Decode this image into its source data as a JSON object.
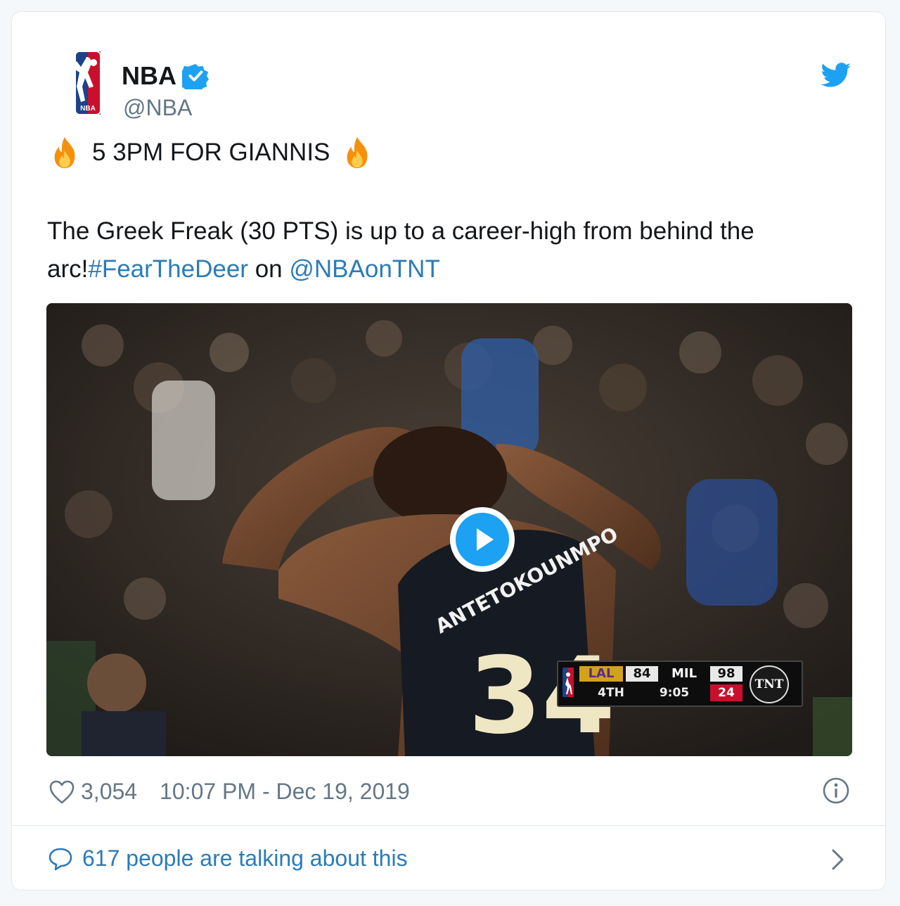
{
  "tweet": {
    "author_name": "NBA",
    "author_handle": "@NBA",
    "headline": "5 3PM FOR GIANNIS",
    "body_prefix": "The Greek Freak (30 PTS) is up to a career-high from behind the arc!",
    "hashtag": "#FearTheDeer",
    "body_middle": " on ",
    "mention": "@NBAonTNT",
    "likes": "3,054",
    "timestamp": "10:07 PM - Dec 19, 2019",
    "talking": "617 people are talking about this"
  },
  "video": {
    "jersey_name": "ANTETOKOUNMPO",
    "jersey_number": "34",
    "scorebug": {
      "team1": "LAL",
      "score1": "84",
      "team2": "MIL",
      "score2": "98",
      "quarter": "4TH",
      "clock": "9:05",
      "shot_clock": "24",
      "network": "TNT"
    }
  },
  "colors": {
    "link": "#2b7bb9",
    "twitter_blue": "#1da1f2",
    "verified": "#1da1f2",
    "muted": "#657786",
    "nba_red": "#c8102e",
    "nba_blue": "#1d428a"
  },
  "icons": [
    "nba-logo-icon",
    "verified-badge-icon",
    "twitter-bird-icon",
    "fire-icon",
    "play-icon",
    "heart-icon",
    "info-icon",
    "reply-bubble-icon",
    "chevron-right-icon"
  ]
}
